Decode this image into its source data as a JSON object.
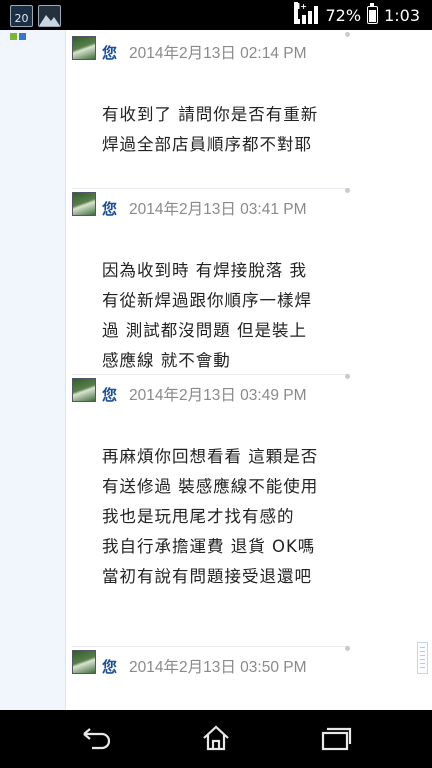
{
  "status_bar": {
    "calendar_day": "20",
    "network_label": "H+",
    "battery_percent": "72%",
    "time": "1:03"
  },
  "messages": [
    {
      "sender": "您",
      "timestamp": "2014年2月13日 02:14 PM",
      "text": "有收到了 請問你是否有重新焊過全部店員順序都不對耶"
    },
    {
      "sender": "您",
      "timestamp": "2014年2月13日 03:41 PM",
      "text": "因為收到時 有焊接脫落 我有從新焊過跟你順序一樣焊過 測試都沒問題 但是裝上感應線 就不會動"
    },
    {
      "sender": "您",
      "timestamp": "2014年2月13日 03:49 PM",
      "text": "再麻煩你回想看看 這顆是否有送修過 裝感應線不能使用 我也是玩甩尾才找有感的\n我自行承擔運費 退貨 OK嗎 當初有說有問題接受退還吧"
    },
    {
      "sender": "您",
      "timestamp": "2014年2月13日 03:50 PM",
      "text": ""
    }
  ],
  "icons": {
    "back": "back-arrow-icon",
    "home": "home-icon",
    "recents": "recent-apps-icon"
  }
}
